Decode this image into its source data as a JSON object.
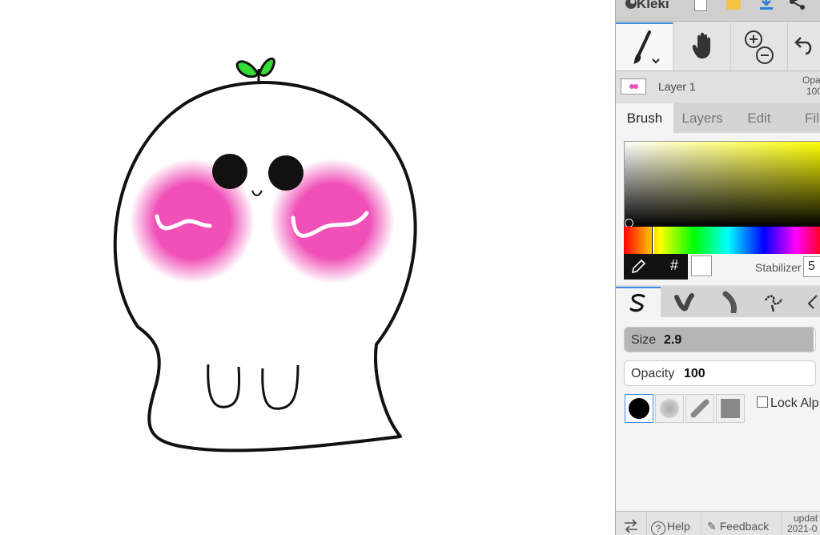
{
  "app": {
    "name": "Kleki"
  },
  "topbar": {
    "icons": [
      "kleki-logo-icon",
      "new-image-icon",
      "open-folder-icon",
      "download-icon",
      "share-icon"
    ]
  },
  "tools": [
    {
      "name": "brush",
      "icon": "brush-icon",
      "active": true
    },
    {
      "name": "hand",
      "icon": "hand-icon",
      "active": false
    },
    {
      "name": "zoom",
      "icon": "zoom-icon",
      "active": false
    },
    {
      "name": "undo",
      "icon": "undo-icon",
      "active": false
    }
  ],
  "layer": {
    "name": "Layer 1",
    "opacity_label": "Opa",
    "opacity_value": "100"
  },
  "tabs": [
    {
      "label": "Brush",
      "active": true
    },
    {
      "label": "Layers",
      "active": false
    },
    {
      "label": "Edit",
      "active": false
    },
    {
      "label": "Fil",
      "active": false
    }
  ],
  "color": {
    "current": "#ffffff",
    "hue_color": "#ffff00",
    "hash_label": "#",
    "stabilizer_label": "Stabilizer",
    "stabilizer_value": "5"
  },
  "brush_types": [
    "pen-brush-icon",
    "blend-brush-icon",
    "sketchy-brush-icon",
    "pixel-brush-icon",
    "eraser-brush-icon"
  ],
  "brush": {
    "size_label": "Size",
    "size_value": "2.9",
    "opacity_label": "Opacity",
    "opacity_value": "100",
    "lock_alpha_label": "Lock Alp"
  },
  "footer": {
    "help_label": "Help",
    "feedback_label": "Feedback",
    "updated_label": "updat",
    "updated_date": "2021-0"
  },
  "drawing": {
    "stroke": "#111111",
    "blush": "#f050b8",
    "sprout": "#33dd33"
  }
}
